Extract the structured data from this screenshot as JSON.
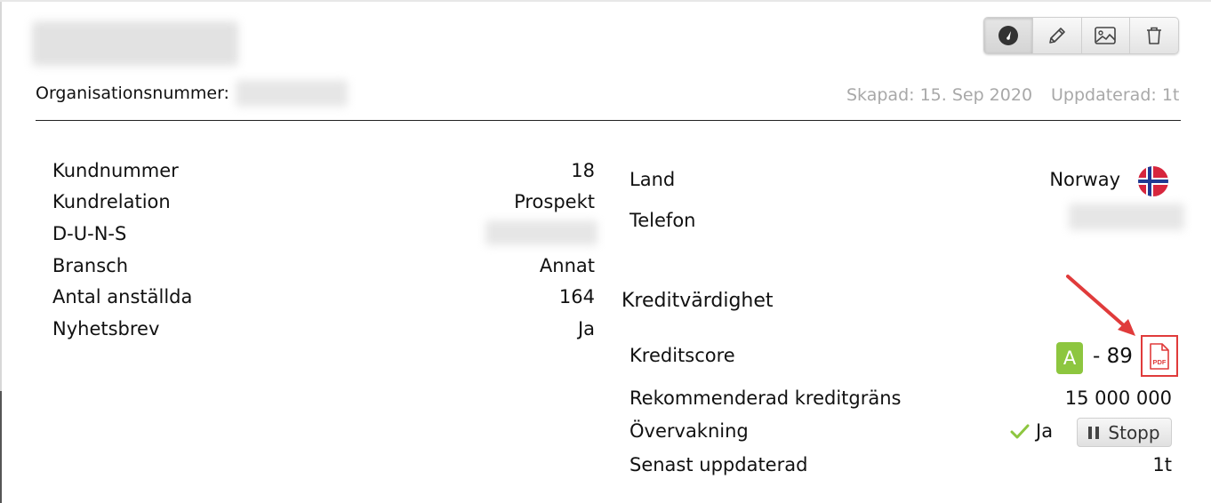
{
  "header": {
    "org_number_label": "Organisationsnummer:",
    "created": "Skapad: 15. Sep 2020",
    "updated": "Uppdaterad: 1t"
  },
  "toolbar": {
    "buttons": [
      {
        "icon": "dashboard-gauge-icon",
        "active": true
      },
      {
        "icon": "pencil-icon"
      },
      {
        "icon": "image-icon"
      },
      {
        "icon": "trash-icon"
      }
    ]
  },
  "left_details": [
    {
      "label": "Kundnummer",
      "value": "18"
    },
    {
      "label": "Kundrelation",
      "value": "Prospekt"
    },
    {
      "label": "D-U-N-S",
      "value": ""
    },
    {
      "label": "Bransch",
      "value": "Annat"
    },
    {
      "label": "Antal anställda",
      "value": "164"
    },
    {
      "label": "Nyhetsbrev",
      "value": "Ja"
    }
  ],
  "right_details": {
    "country_label": "Land",
    "country_value": "Norway",
    "country_flag": "norway-flag-icon",
    "phone_label": "Telefon"
  },
  "credit": {
    "section_title": "Kreditvärdighet",
    "score_label": "Kreditscore",
    "grade": "A",
    "grade_color": "#8dc63f",
    "score": "- 89",
    "pdf_icon": "pdf-file-icon",
    "pdf_label": "PDF",
    "highlight_color": "#e03b3b",
    "limit_label": "Rekommenderad kreditgräns",
    "limit_value": "15 000 000",
    "monitoring_label": "Övervakning",
    "monitoring_value": "Ja",
    "stop_button": "Stopp",
    "last_updated_label": "Senast uppdaterad",
    "last_updated_value": "1t"
  }
}
